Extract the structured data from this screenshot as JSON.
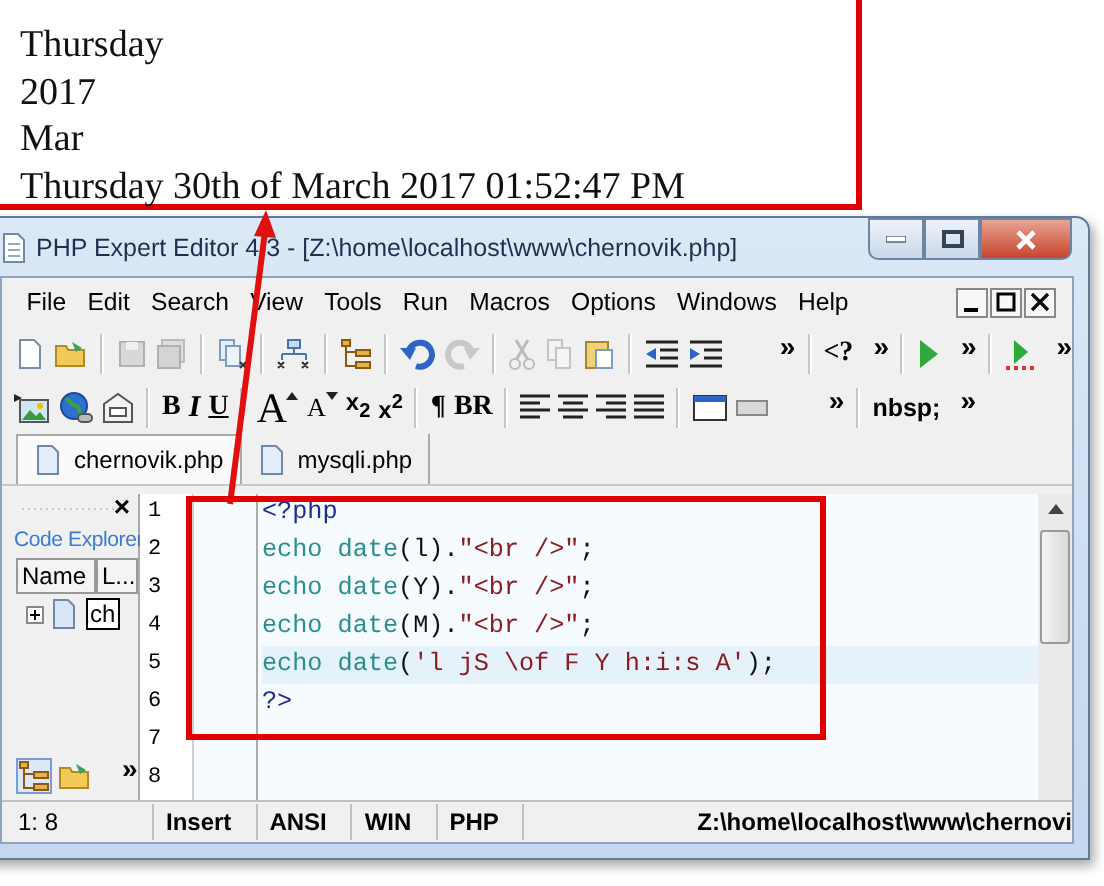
{
  "output": {
    "lines": [
      "Thursday",
      "2017",
      "Mar",
      "Thursday 30th of March 2017 01:52:47 PM"
    ]
  },
  "window": {
    "title": "PHP Expert Editor 4.3 - [Z:\\home\\localhost\\www\\chernovik.php]"
  },
  "menu": [
    "File",
    "Edit",
    "Search",
    "View",
    "Tools",
    "Run",
    "Macros",
    "Options",
    "Windows",
    "Help"
  ],
  "toolbar_1": {
    "php_tag": "<?",
    "more": [
      "»",
      "»",
      "»",
      "»"
    ]
  },
  "toolbar_2": {
    "bold": "B",
    "italic": "I",
    "underline": "U",
    "grow_font": "A",
    "shrink_font": "A",
    "subscript": "x$_{2}$",
    "superscript": "x$^{2}$",
    "paragraph": "¶",
    "line_break": "BR",
    "nbsp": "nbsp;",
    "more": [
      "»",
      "»"
    ]
  },
  "tabs": [
    {
      "label": "chernovik.php",
      "selected": true
    },
    {
      "label": "mysqli.php",
      "selected": false
    }
  ],
  "code_explorer": {
    "close": "×",
    "title": "Code Explorer",
    "columns": [
      "Name",
      "L..."
    ],
    "tree": [
      {
        "label": "ch",
        "expanded": false
      }
    ],
    "more": "»"
  },
  "editor": {
    "line_numbers": [
      "1",
      "2",
      "3",
      "4",
      "5",
      "6",
      "7",
      "8"
    ],
    "lines": [
      {
        "current": false,
        "tokens": [
          {
            "kind": "tag",
            "text": "<?php"
          }
        ]
      },
      {
        "current": false,
        "tokens": [
          {
            "kind": "keyword",
            "text": "echo"
          },
          {
            "kind": "keyword",
            "text": " date"
          },
          {
            "kind": "punct",
            "text": "(l)."
          },
          {
            "kind": "string",
            "text": "\"<br />\""
          },
          {
            "kind": "punct",
            "text": ";"
          }
        ]
      },
      {
        "current": false,
        "tokens": [
          {
            "kind": "keyword",
            "text": "echo"
          },
          {
            "kind": "keyword",
            "text": " date"
          },
          {
            "kind": "punct",
            "text": "(Y)."
          },
          {
            "kind": "string",
            "text": "\"<br />\""
          },
          {
            "kind": "punct",
            "text": ";"
          }
        ]
      },
      {
        "current": false,
        "tokens": [
          {
            "kind": "keyword",
            "text": "echo"
          },
          {
            "kind": "keyword",
            "text": " date"
          },
          {
            "kind": "punct",
            "text": "(M)."
          },
          {
            "kind": "string",
            "text": "\"<br />\""
          },
          {
            "kind": "punct",
            "text": ";"
          }
        ]
      },
      {
        "current": true,
        "tokens": [
          {
            "kind": "keyword",
            "text": "echo"
          },
          {
            "kind": "keyword",
            "text": " date"
          },
          {
            "kind": "punct",
            "text": "("
          },
          {
            "kind": "string",
            "text": "'l jS \\of F Y h:i:s A'"
          },
          {
            "kind": "punct",
            "text": ");"
          }
        ]
      },
      {
        "current": false,
        "tokens": [
          {
            "kind": "tag",
            "text": "?>"
          }
        ]
      }
    ]
  },
  "status_bar": [
    "1: 8",
    "Insert",
    "ANSI",
    "WIN",
    "PHP",
    "Z:\\home\\localhost\\www\\chernovi"
  ]
}
